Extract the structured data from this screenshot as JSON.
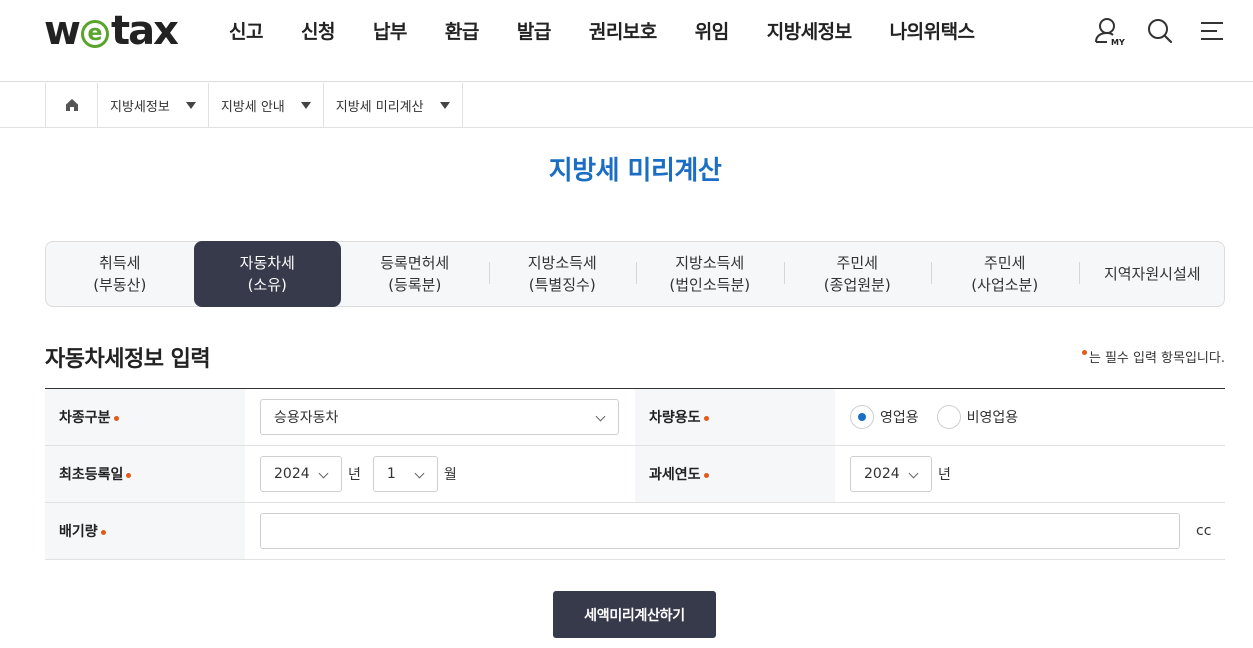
{
  "header": {
    "logo_prefix": "w",
    "logo_e": "e",
    "logo_suffix": "tax",
    "nav": [
      "신고",
      "신청",
      "납부",
      "환급",
      "발급",
      "권리보호",
      "위임",
      "지방세정보",
      "나의위택스"
    ],
    "my_badge": "MY",
    "icons": [
      "my-user-icon",
      "search-icon",
      "menu-icon"
    ]
  },
  "breadcrumb": {
    "home_icon": "home-icon",
    "items": [
      "지방세정보",
      "지방세 안내",
      "지방세 미리계산"
    ]
  },
  "page_title": "지방세 미리계산",
  "tabs": [
    {
      "line1": "취득세",
      "line2": "(부동산)",
      "active": false
    },
    {
      "line1": "자동차세",
      "line2": "(소유)",
      "active": true
    },
    {
      "line1": "등록면허세",
      "line2": "(등록분)",
      "active": false
    },
    {
      "line1": "지방소득세",
      "line2": "(특별징수)",
      "active": false
    },
    {
      "line1": "지방소득세",
      "line2": "(법인소득분)",
      "active": false
    },
    {
      "line1": "주민세",
      "line2": "(종업원분)",
      "active": false
    },
    {
      "line1": "주민세",
      "line2": "(사업소분)",
      "active": false
    },
    {
      "line1": "지역자원시설세",
      "line2": "",
      "active": false
    }
  ],
  "section": {
    "title": "자동차세정보 입력",
    "required_note": "는 필수 입력 항목입니다."
  },
  "form": {
    "vehicle_type_label": "차종구분",
    "vehicle_type_value": "승용자동차",
    "vehicle_use_label": "차량용도",
    "use_option_business": "영업용",
    "use_option_nonbusiness": "비영업용",
    "use_selected": "영업용",
    "first_reg_label": "최초등록일",
    "first_reg_year": "2024",
    "year_unit": "년",
    "first_reg_month": "1",
    "month_unit": "월",
    "tax_year_label": "과세연도",
    "tax_year_value": "2024",
    "tax_year_unit": "년",
    "displacement_label": "배기량",
    "displacement_value": "",
    "displacement_unit": "cc"
  },
  "submit_label": "세액미리계산하기",
  "colors": {
    "accent_blue": "#1c6ec4",
    "dark_navy": "#373a4b",
    "required_dot": "#e15a1a",
    "logo_green": "#5aa32c"
  }
}
